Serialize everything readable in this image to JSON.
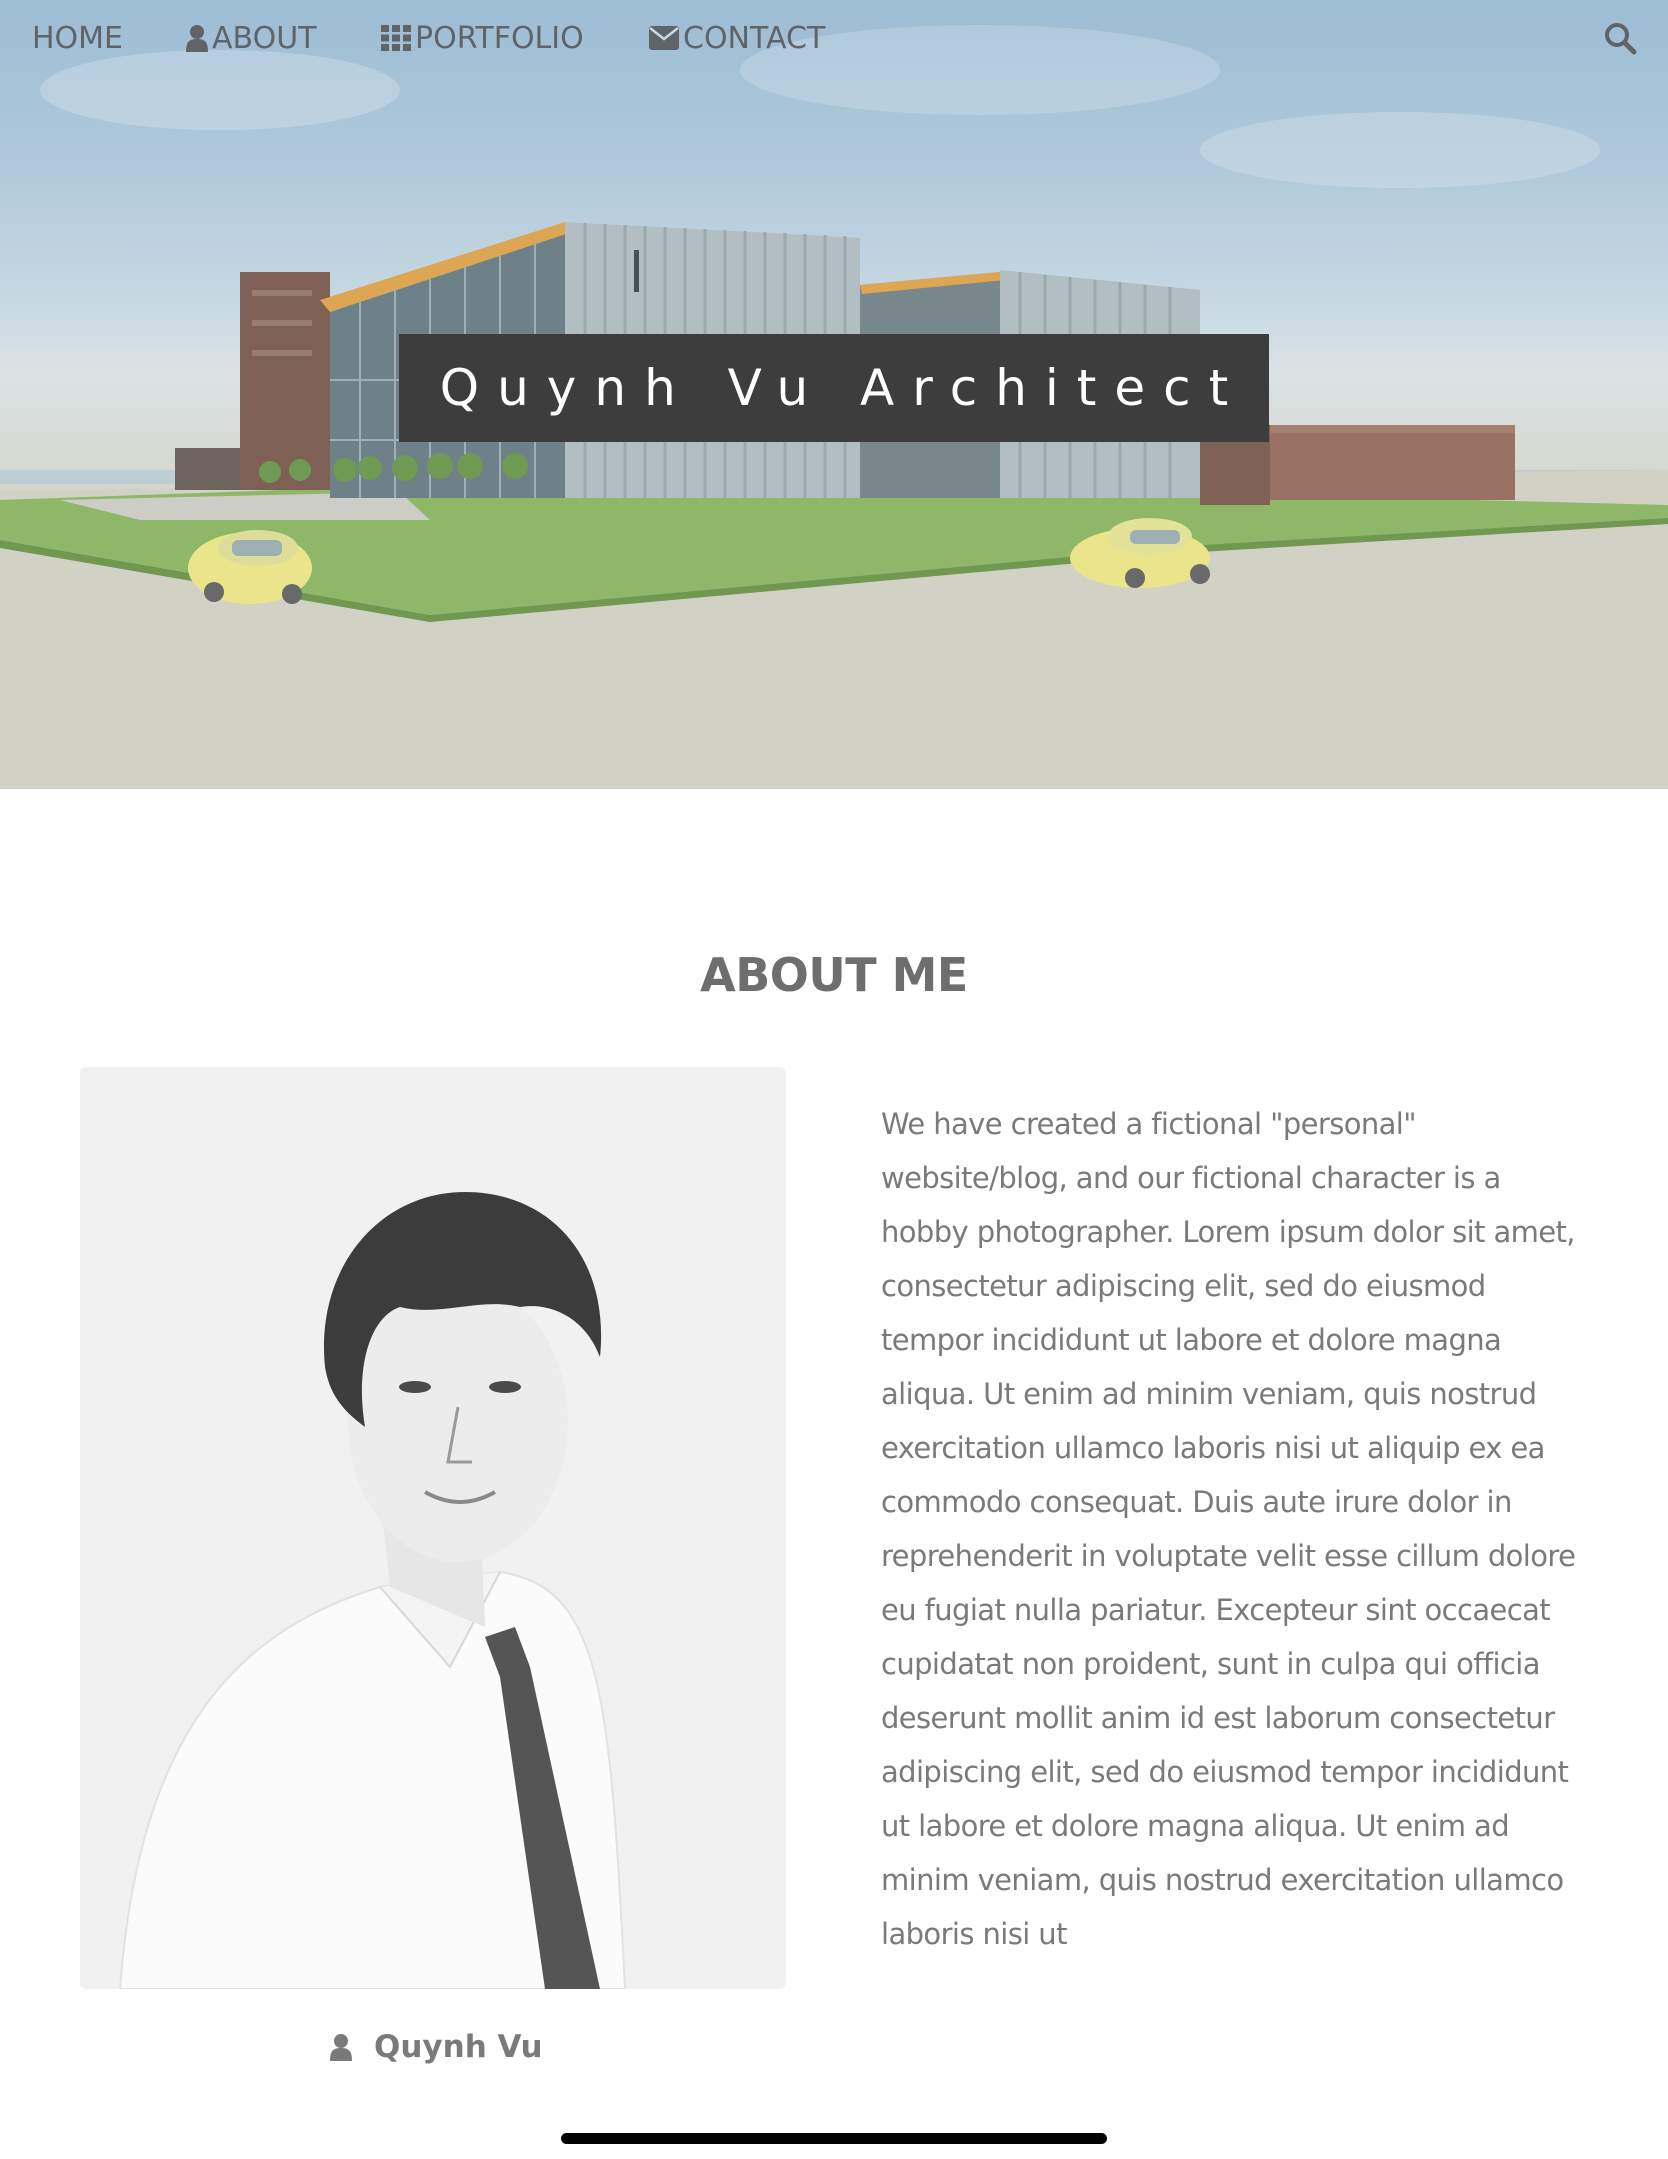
{
  "nav": {
    "items": [
      {
        "label": "HOME",
        "icon": ""
      },
      {
        "label": "ABOUT",
        "icon": "user-icon"
      },
      {
        "label": "PORTFOLIO",
        "icon": "grid-icon"
      },
      {
        "label": "CONTACT",
        "icon": "envelope-icon"
      }
    ],
    "search_icon": "search-icon"
  },
  "hero": {
    "title": "Quynh Vu Architect"
  },
  "about": {
    "heading": "ABOUT ME",
    "bio": "We have created a fictional \"personal\" website/blog, and our fictional character is a hobby photographer. Lorem ipsum dolor sit amet, consectetur adipiscing elit, sed do eiusmod tempor incididunt ut labore et dolore magna aliqua. Ut enim ad minim veniam, quis nostrud exercitation ullamco laboris nisi ut aliquip ex ea commodo consequat. Duis aute irure dolor in reprehenderit in voluptate velit esse cillum dolore eu fugiat nulla pariatur. Excepteur sint occaecat cupidatat non proident, sunt in culpa qui officia deserunt mollit anim id est laborum consectetur adipiscing elit, sed do eiusmod tempor incididunt ut labore et dolore magna aliqua. Ut enim ad minim veniam, quis nostrud exercitation ullamco laboris nisi ut",
    "caption_name": "Quynh Vu",
    "caption_icon": "user-icon"
  },
  "colors": {
    "text": "#6b6b6b",
    "title_box": "#3d3d3d",
    "photo_bg": "#f1f1f1"
  }
}
